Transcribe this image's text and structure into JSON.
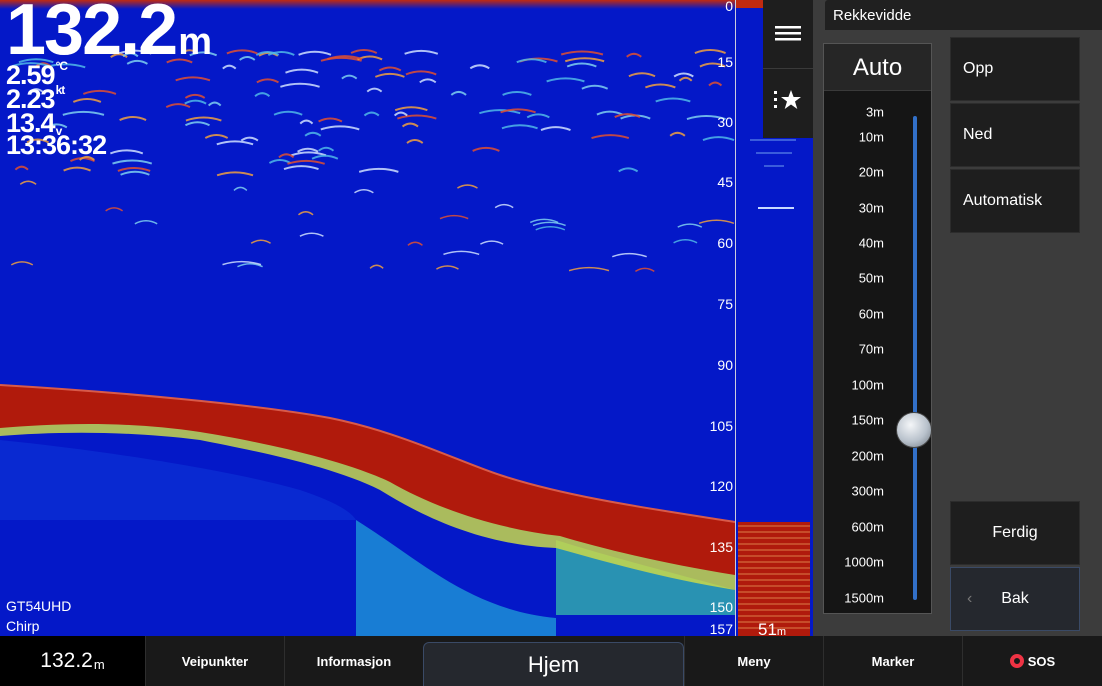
{
  "readouts": {
    "depth_value": "132.2",
    "depth_unit": "m",
    "temperature": "2.59",
    "temperature_unit": "°C",
    "speed": "2.23",
    "speed_unit": "kt",
    "voltage": "13.4",
    "voltage_unit": "v",
    "time": "13:36:32"
  },
  "transducer": {
    "model": "GT54UHD",
    "mode": "Chirp"
  },
  "depth_scale": [
    "0",
    "15",
    "30",
    "45",
    "60",
    "75",
    "90",
    "105",
    "120",
    "135",
    "150",
    "157"
  ],
  "fish_depth_label": {
    "value": "51",
    "unit": "m"
  },
  "side_panel": {
    "title": "Rekkevidde",
    "mode": "Auto",
    "scale_labels": [
      "3m",
      "10m",
      "20m",
      "30m",
      "40m",
      "50m",
      "60m",
      "70m",
      "100m",
      "150m",
      "200m",
      "300m",
      "600m",
      "1000m",
      "1500m"
    ],
    "selected": "150m",
    "buttons": {
      "up": "Opp",
      "down": "Ned",
      "auto": "Automatisk",
      "done": "Ferdig",
      "back": "Bak"
    }
  },
  "bottom_bar": {
    "depth_value": "132.2",
    "depth_unit": "m",
    "waypoints": "Veipunkter",
    "information": "Informasjon",
    "home": "Hjem",
    "menu": "Meny",
    "markers": "Marker",
    "sos": "SOS"
  },
  "colors": {
    "water": "#0418c8",
    "bottom_red": "#b01a0c",
    "accent": "#3270c8",
    "sos": "#ee3344"
  },
  "icons": [
    "menu-icon",
    "waypoint-star-icon",
    "chevron-left-icon",
    "sos-ring-icon"
  ]
}
